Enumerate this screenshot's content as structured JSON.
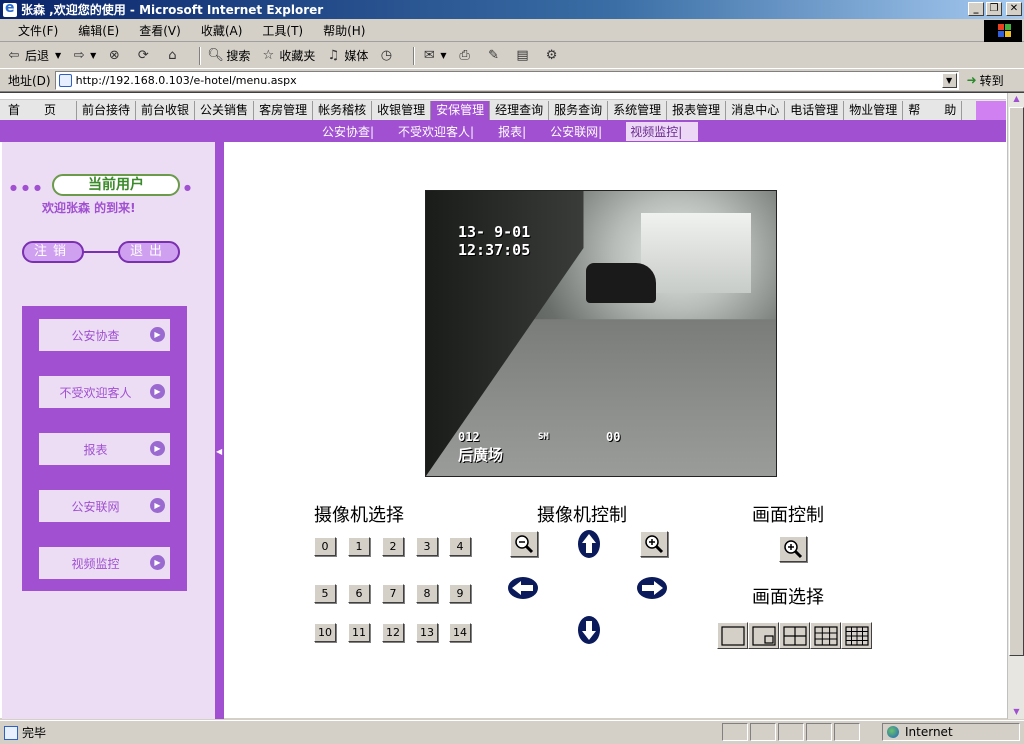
{
  "window": {
    "title": "张森 ,欢迎您的使用 - Microsoft Internet Explorer",
    "minimize": "_",
    "restore": "❐",
    "close": "✕"
  },
  "menubar": {
    "items": [
      "文件(F)",
      "编辑(E)",
      "查看(V)",
      "收藏(A)",
      "工具(T)",
      "帮助(H)"
    ]
  },
  "toolbar": {
    "back": "后退",
    "search": "搜索",
    "favorites": "收藏夹",
    "media": "媒体"
  },
  "addressbar": {
    "label": "地址(D)",
    "url": "http://192.168.0.103/e-hotel/menu.aspx",
    "go": "转到"
  },
  "topnav": {
    "items": [
      "首　　页",
      "前台接待",
      "前台收银",
      "公关销售",
      "客房管理",
      "帐务稽核",
      "收银管理",
      "安保管理",
      "经理查询",
      "服务查询",
      "系统管理",
      "报表管理",
      "消息中心",
      "电话管理",
      "物业管理",
      "帮　　助"
    ],
    "active_index": 7
  },
  "subnav": {
    "items": [
      "公安协查|",
      "不受欢迎客人|",
      "报表|",
      "公安联网|",
      "视频监控|"
    ]
  },
  "sidebar": {
    "current_user_label": "当前用户",
    "welcome": "欢迎张森  的到来!",
    "logout": "注销",
    "exit": "退出",
    "menu": [
      "公安协查",
      "不受欢迎客人",
      "报表",
      "公安联网",
      "视频监控"
    ]
  },
  "camera_feed": {
    "date": "13- 9-01",
    "time": "12:37:05",
    "cam_id": "012",
    "mode": "SM",
    "num": "00",
    "location": "后廣场"
  },
  "controls": {
    "camera_select_title": "摄像机选择",
    "camera_control_title": "摄像机控制",
    "picture_control_title": "画面控制",
    "picture_select_title": "画面选择",
    "camera_buttons": [
      "0",
      "1",
      "2",
      "3",
      "4",
      "5",
      "6",
      "7",
      "8",
      "9",
      "10",
      "11",
      "12",
      "13",
      "14"
    ]
  },
  "statusbar": {
    "status": "完毕",
    "zone": "Internet"
  },
  "colors": {
    "accent": "#a050d0",
    "sidebar_bg": "#ecdcf4"
  }
}
